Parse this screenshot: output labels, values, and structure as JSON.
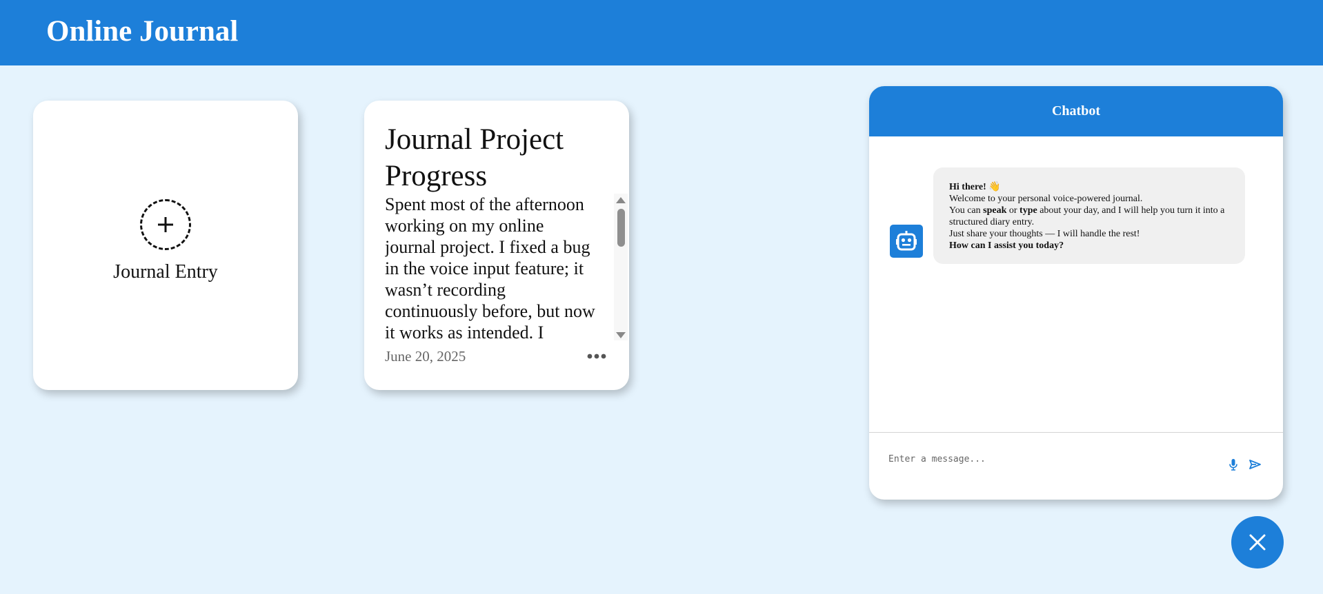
{
  "header": {
    "title": "Online Journal"
  },
  "new_entry": {
    "label": "Journal Entry",
    "icon": "plus-icon"
  },
  "entries": [
    {
      "title": "Journal Project Progress",
      "body": "Spent most of the afternoon working on my online journal project. I fixed a bug in the voice input feature; it wasn’t recording continuously before, but now it works as intended. I",
      "date": "June 20, 2025",
      "menu_icon": "more-horizontal-icon"
    }
  ],
  "chatbot": {
    "title": "Chatbot",
    "avatar_icon": "robot-icon",
    "greeting": {
      "hello": "Hi there!",
      "wave_emoji": "👋",
      "welcome": "Welcome to your personal voice-powered journal.",
      "you_can": "You can",
      "speak": "speak",
      "or": "or",
      "type": "type",
      "rest_line": "about your day, and I will help you turn it into a structured diary entry.",
      "share": "Just share your thoughts — I will handle the rest!",
      "ask": "How can I assist you today?"
    },
    "input": {
      "placeholder": "Enter a message...",
      "value": ""
    },
    "mic_icon": "microphone-icon",
    "send_icon": "send-icon",
    "close_icon": "close-icon"
  },
  "colors": {
    "primary": "#1d7fd9",
    "background": "#e5f3fd",
    "card": "#ffffff",
    "bubble": "#f0f0f0"
  }
}
